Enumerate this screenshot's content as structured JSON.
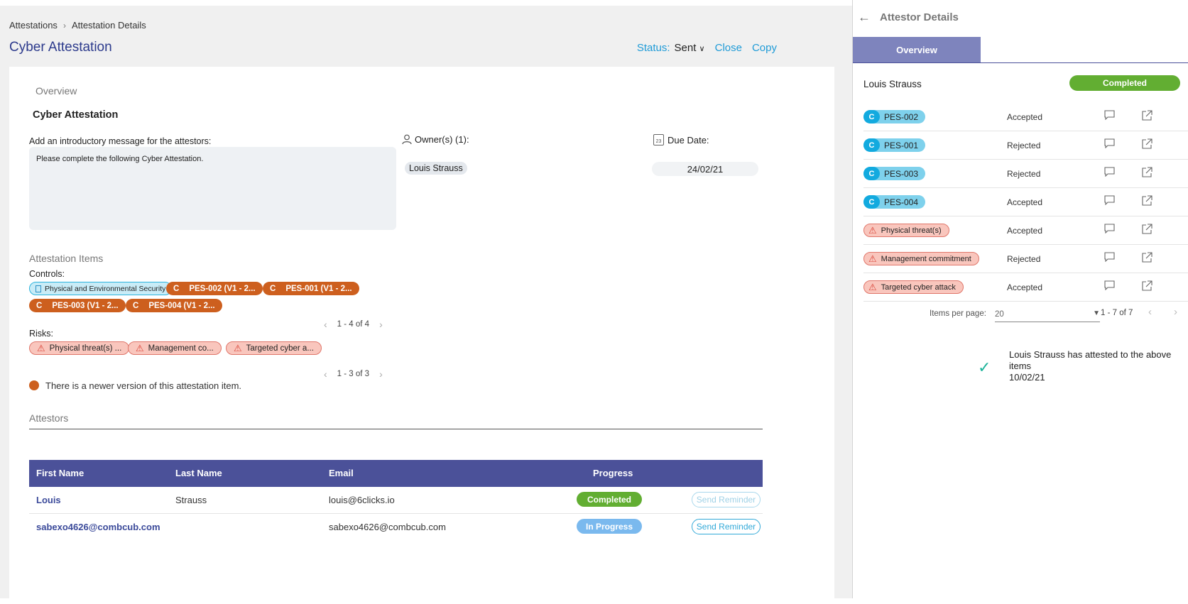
{
  "breadcrumb": {
    "root": "Attestations",
    "current": "Attestation Details"
  },
  "page": {
    "title": "Cyber Attestation"
  },
  "actions": {
    "status_label": "Status:",
    "status_value": "Sent",
    "close": "Close",
    "copy": "Copy"
  },
  "overview": {
    "section": "Overview",
    "name": "Cyber Attestation",
    "message_label": "Add an introductory message for the attestors:",
    "message": "Please complete the following Cyber Attestation.",
    "owners_label": "Owner(s) (1):",
    "owner": "Louis Strauss",
    "due_label": "Due Date:",
    "due_icon_day": "23",
    "due_date": "24/02/21"
  },
  "items": {
    "section": "Attestation Items",
    "controls_label": "Controls:",
    "controls": [
      {
        "icon": "C",
        "label": "PES-002 (V1 - 2..."
      },
      {
        "icon": "C",
        "label": "PES-001 (V1 - 2..."
      },
      {
        "icon": "C",
        "label": "PES-003 (V1 - 2..."
      },
      {
        "icon": "C",
        "label": "PES-004 (V1 - 2..."
      }
    ],
    "domain_chip": "Physical and Environmental Security",
    "controls_pager": "1 - 4 of 4",
    "risks_label": "Risks:",
    "risks": [
      "Physical threat(s) ...",
      "Management co...",
      "Targeted cyber a..."
    ],
    "risks_pager": "1 - 3 of 3",
    "legend": "There is a newer version of this attestation item."
  },
  "attestors": {
    "section": "Attestors",
    "columns": [
      "First Name",
      "Last Name",
      "Email",
      "Progress"
    ],
    "rows": [
      {
        "first": "Louis",
        "last": "Strauss",
        "email": "louis@6clicks.io",
        "progress": "Completed",
        "action": "Send Reminder"
      },
      {
        "first": "sabexo4626@combcub.com",
        "last": "",
        "email": "sabexo4626@combcub.com",
        "progress": "In Progress",
        "action": "Send Reminder"
      }
    ]
  },
  "panel": {
    "title": "Attestor Details",
    "tab": "Overview",
    "attestor": "Louis Strauss",
    "status": "Completed",
    "items": [
      {
        "kind": "control",
        "icon": "C",
        "label": "PES-002",
        "result": "Accepted"
      },
      {
        "kind": "control",
        "icon": "C",
        "label": "PES-001",
        "result": "Rejected"
      },
      {
        "kind": "control",
        "icon": "C",
        "label": "PES-003",
        "result": "Rejected"
      },
      {
        "kind": "control",
        "icon": "C",
        "label": "PES-004",
        "result": "Accepted"
      },
      {
        "kind": "risk",
        "label": "Physical threat(s)",
        "result": "Accepted"
      },
      {
        "kind": "risk",
        "label": "Management commitment",
        "result": "Rejected"
      },
      {
        "kind": "risk",
        "label": "Targeted cyber attack",
        "result": "Accepted"
      }
    ],
    "per_page_label": "Items per page:",
    "per_page": "20",
    "range": "1 - 7 of 7",
    "confirmation": "Louis Strauss has attested to the above items",
    "confirmation_date": "10/02/21"
  },
  "colors": {
    "primary": "#4b5199",
    "accent": "#1f9bd7",
    "orange": "#cd5f1e",
    "green": "#62ae32",
    "risk": "#f9c6bd"
  }
}
